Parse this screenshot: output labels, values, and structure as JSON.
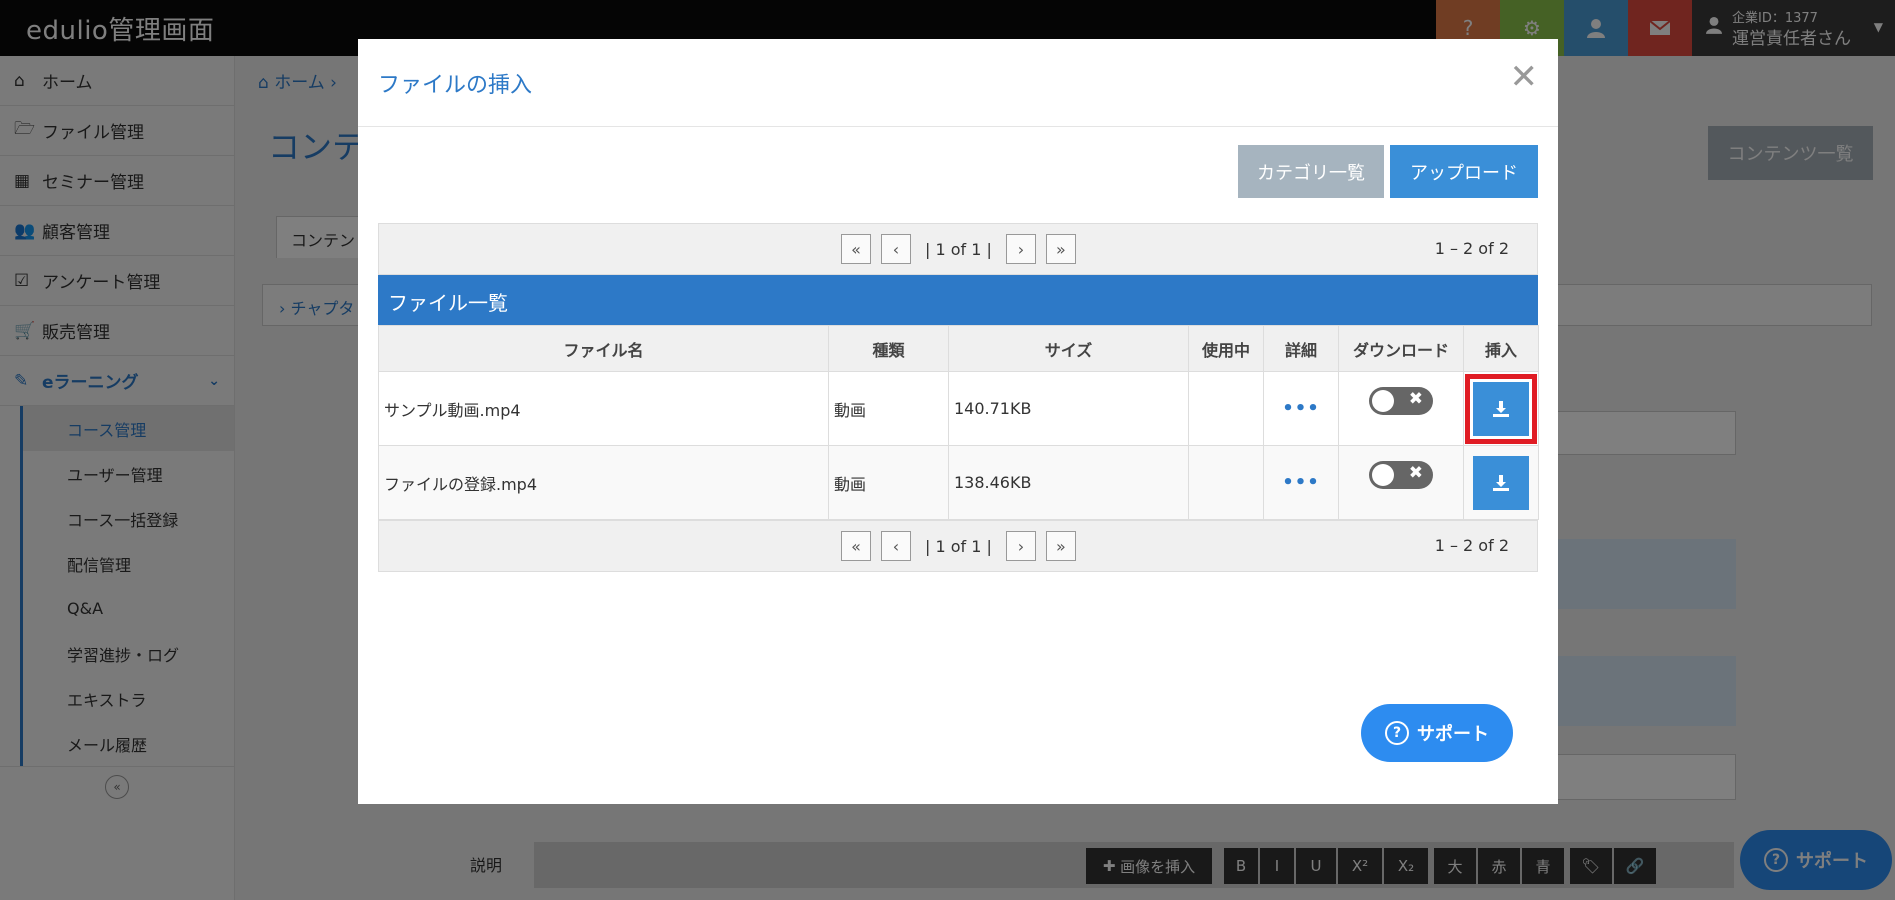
{
  "app": {
    "title": "edulio管理画面"
  },
  "topbar": {
    "icons": [
      "question-icon",
      "gear-icon",
      "user-icon",
      "mail-icon"
    ],
    "account": {
      "company_id": "企業ID：1377",
      "user": "運営責任者さん"
    }
  },
  "sidebar": {
    "items": [
      {
        "label": "ホーム",
        "icon": "home-icon"
      },
      {
        "label": "ファイル管理",
        "icon": "folder-icon"
      },
      {
        "label": "セミナー管理",
        "icon": "calendar-icon"
      },
      {
        "label": "顧客管理",
        "icon": "users-icon"
      },
      {
        "label": "アンケート管理",
        "icon": "checkbox-icon"
      },
      {
        "label": "販売管理",
        "icon": "cart-icon"
      }
    ],
    "elearning": {
      "label": "eラーニング",
      "subitems": [
        "コース管理",
        "ユーザー管理",
        "コース一括登録",
        "配信管理",
        "Q&A",
        "学習進捗・ログ",
        "エキストラ",
        "メール履歴"
      ]
    }
  },
  "background": {
    "breadcrumb": "ホーム",
    "page_title": "コンテ",
    "content_list_button": "コンテンツ一覧",
    "tab_fragment": "コンテン",
    "chapter_fragment": "チャプタ",
    "description_label": "説明",
    "editor": {
      "insert_image": "画像を挿入",
      "bold": "B",
      "italic": "I",
      "underline": "U",
      "sup": "X²",
      "sub": "X₂",
      "large": "大",
      "red": "赤",
      "blue": "青"
    }
  },
  "modal": {
    "title": "ファイルの挿入",
    "category_button": "カテゴリ一覧",
    "upload_button": "アップロード",
    "pager": {
      "page_text": "| 1 of 1 |",
      "count": "1 – 2 of 2"
    },
    "list_header": "ファイル一覧",
    "columns": [
      "ファイル名",
      "種類",
      "サイズ",
      "使用中",
      "詳細",
      "ダウンロード",
      "挿入"
    ],
    "rows": [
      {
        "name": "サンプル動画.mp4",
        "type": "動画",
        "size": "140.71KB",
        "in_use": "",
        "detail": "•••"
      },
      {
        "name": "ファイルの登録.mp4",
        "type": "動画",
        "size": "138.46KB",
        "in_use": "",
        "detail": "•••"
      }
    ]
  },
  "support": {
    "label": "サポート"
  },
  "colors": {
    "primary": "#2d79c7",
    "button_blue": "#3a8fd8",
    "highlight": "#e01c24"
  }
}
